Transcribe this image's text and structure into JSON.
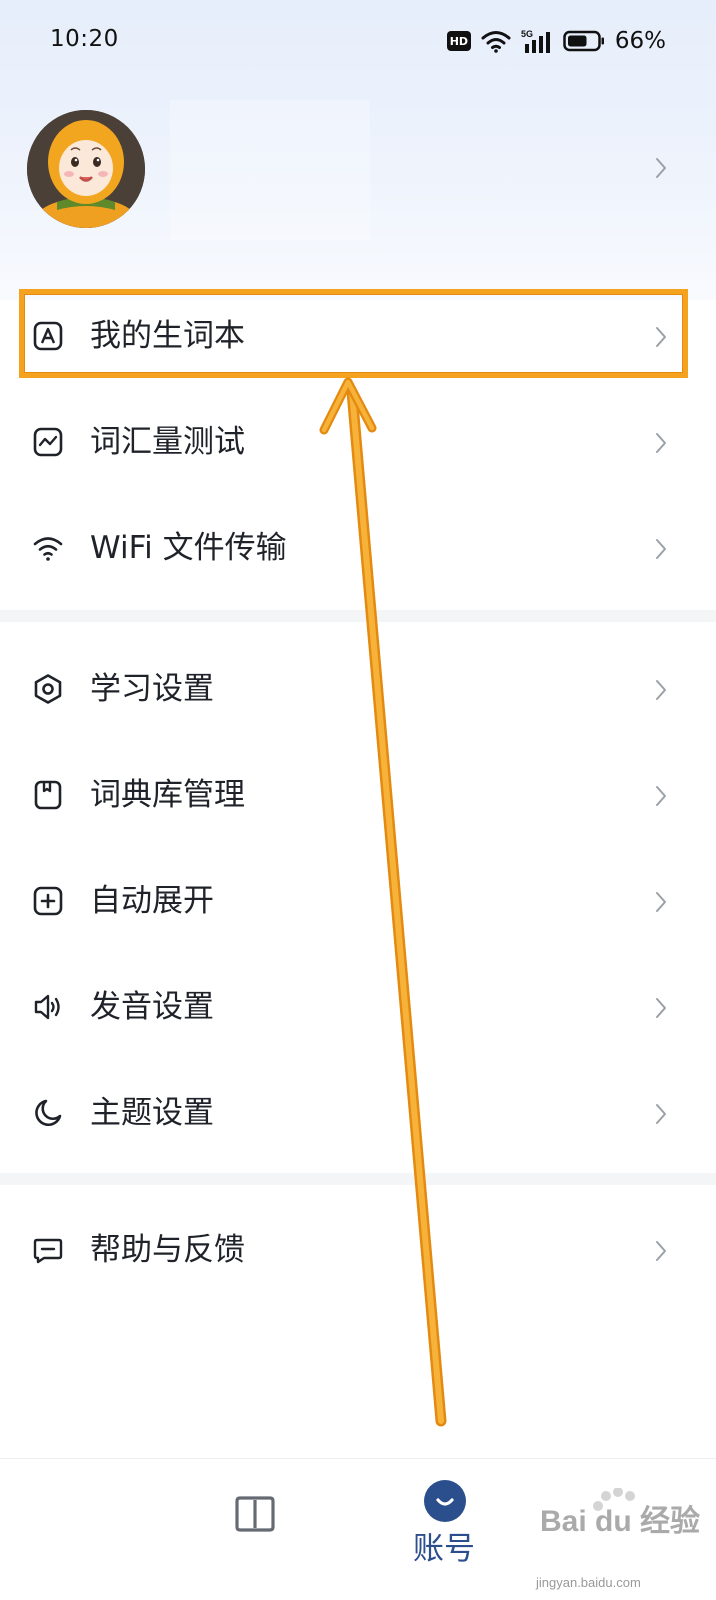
{
  "status_bar": {
    "time": "10:20",
    "network_badge": "HD",
    "network_type": "5G",
    "battery_percent": "66%",
    "battery_level": 0.66
  },
  "profile": {
    "avatar_icon": "avatar-character-icon"
  },
  "menu": {
    "group1": [
      {
        "label": "我的生词本",
        "icon": "vocabulary-book-icon"
      },
      {
        "label": "词汇量测试",
        "icon": "trend-chart-icon"
      },
      {
        "label": "WiFi 文件传输",
        "icon": "wifi-icon"
      }
    ],
    "group2": [
      {
        "label": "学习设置",
        "icon": "hexagon-settings-icon"
      },
      {
        "label": "词典库管理",
        "icon": "dictionary-library-icon"
      },
      {
        "label": "自动展开",
        "icon": "plus-square-icon"
      },
      {
        "label": "发音设置",
        "icon": "speaker-icon"
      },
      {
        "label": "主题设置",
        "icon": "moon-icon"
      }
    ],
    "group3": [
      {
        "label": "帮助与反馈",
        "icon": "feedback-chat-icon"
      }
    ]
  },
  "bottom_nav": {
    "items": [
      {
        "label": "",
        "icon": "book-icon",
        "active": false
      },
      {
        "label": "账号",
        "icon": "account-face-icon",
        "active": true
      }
    ]
  },
  "annotation": {
    "color": "#f5a21f"
  },
  "watermark": {
    "brand": "Bai du 经验",
    "url": "jingyan.baidu.com"
  },
  "colors": {
    "accent": "#2b4f8c",
    "highlight": "#f5a21f",
    "separator": "#f4f5f7"
  }
}
